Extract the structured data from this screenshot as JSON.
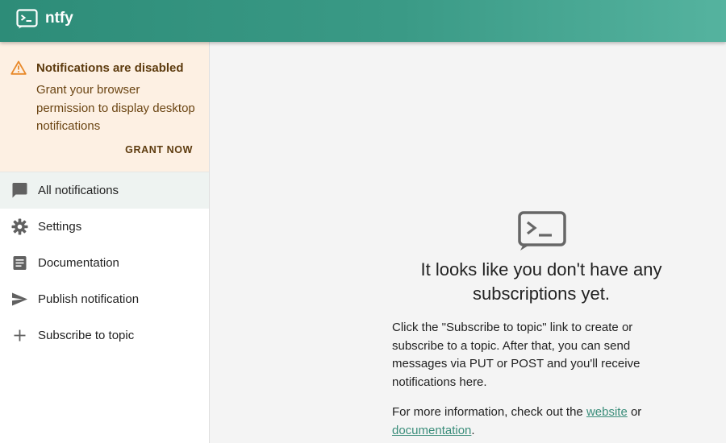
{
  "app": {
    "title": "ntfy",
    "icon": "terminal-icon",
    "brand_color": "#338574"
  },
  "alert": {
    "icon": "warning-icon",
    "title": "Notifications are disabled",
    "body": "Grant your browser permission to display desktop notifications",
    "action": "GRANT NOW"
  },
  "nav": {
    "items": [
      {
        "label": "All notifications",
        "icon": "chat-bubble-icon",
        "active": true
      },
      {
        "label": "Settings",
        "icon": "gear-icon"
      },
      {
        "label": "Documentation",
        "icon": "document-icon"
      },
      {
        "label": "Publish notification",
        "icon": "send-icon"
      },
      {
        "label": "Subscribe to topic",
        "icon": "plus-icon"
      }
    ]
  },
  "main": {
    "empty_icon": "terminal-icon",
    "title": "It looks like you don't have any subscriptions yet.",
    "body": "Click the \"Subscribe to topic\" link to create or subscribe to a topic. After that, you can send messages via PUT or POST and you'll receive notifications here.",
    "more_prefix": "For more information, check out the ",
    "website_link": "website",
    "more_mid": " or ",
    "documentation_link": "documentation",
    "more_suffix": "."
  }
}
